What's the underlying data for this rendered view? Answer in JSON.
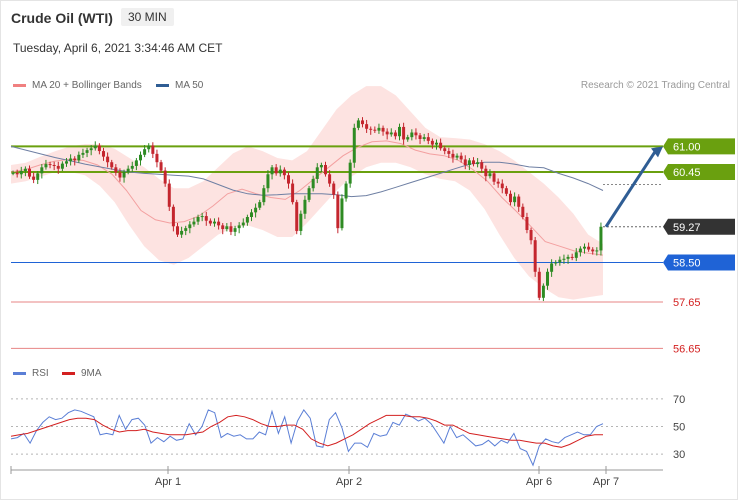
{
  "header": {
    "instrument": "Crude Oil (WTI)",
    "timeframe": "30 MIN",
    "timestamp": "Tuesday, April 6, 2021 3:34:46 AM CET"
  },
  "legend": {
    "items": [
      {
        "label": "MA 20 + Bollinger Bands",
        "color": "#f08080"
      },
      {
        "label": "MA 50",
        "color": "#2f5d94"
      }
    ],
    "credit": "Research © 2021 Trading Central"
  },
  "rsi_legend": {
    "items": [
      {
        "label": "RSI",
        "color": "#5b7fd6"
      },
      {
        "label": "9MA",
        "color": "#d32020"
      }
    ]
  },
  "chart_data": [
    {
      "type": "candlestick",
      "title": "Crude Oil (WTI)",
      "ylim": [
        56.4,
        62.0
      ],
      "x_labels": [
        "Apr 1",
        "Apr 2",
        "Apr 6",
        "Apr 7"
      ],
      "levels": [
        {
          "value": 61.0,
          "label": "61.00",
          "kind": "resistance",
          "color": "#6aa00f"
        },
        {
          "value": 60.45,
          "label": "60.45",
          "kind": "resistance",
          "color": "#6aa00f"
        },
        {
          "value": 59.27,
          "label": "59.27",
          "kind": "last",
          "color": "#333333"
        },
        {
          "value": 58.5,
          "label": "58.50",
          "kind": "pivot",
          "color": "#1f63d6"
        },
        {
          "value": 57.65,
          "label": "57.65",
          "kind": "support",
          "color": "#d32020"
        },
        {
          "value": 56.65,
          "label": "56.65",
          "kind": "support",
          "color": "#d32020"
        }
      ],
      "closes": [
        60.43,
        60.4,
        60.47,
        60.52,
        60.35,
        60.28,
        60.42,
        60.55,
        60.62,
        60.6,
        60.58,
        60.52,
        60.63,
        60.68,
        60.74,
        60.7,
        60.82,
        60.86,
        60.92,
        60.96,
        61.02,
        60.9,
        60.78,
        60.66,
        60.55,
        60.44,
        60.33,
        60.45,
        60.52,
        60.58,
        60.7,
        60.82,
        60.94,
        61.02,
        60.84,
        60.66,
        60.48,
        60.2,
        59.7,
        59.28,
        59.1,
        59.18,
        59.24,
        59.32,
        59.38,
        59.48,
        59.5,
        59.4,
        59.34,
        59.38,
        59.3,
        59.22,
        59.28,
        59.16,
        59.24,
        59.3,
        59.36,
        59.48,
        59.58,
        59.68,
        59.8,
        60.1,
        60.4,
        60.55,
        60.42,
        60.5,
        60.38,
        60.2,
        59.8,
        59.18,
        59.55,
        59.85,
        60.1,
        60.3,
        60.55,
        60.6,
        60.4,
        60.2,
        59.96,
        59.24,
        59.88,
        60.2,
        60.65,
        61.4,
        61.56,
        61.48,
        61.38,
        61.36,
        61.34,
        61.4,
        61.32,
        61.26,
        61.3,
        61.22,
        61.42,
        61.15,
        61.2,
        61.3,
        61.24,
        61.16,
        61.2,
        61.12,
        61.04,
        61.08,
        60.96,
        60.9,
        60.84,
        60.76,
        60.8,
        60.72,
        60.6,
        60.7,
        60.62,
        60.66,
        60.52,
        60.36,
        60.42,
        60.24,
        60.2,
        60.1,
        59.98,
        59.8,
        59.92,
        59.7,
        59.48,
        59.2,
        58.98,
        58.3,
        57.74,
        58.0,
        58.3,
        58.48,
        58.5,
        58.56,
        58.58,
        58.62,
        58.6,
        58.72,
        58.8,
        58.84,
        58.78,
        58.74,
        58.76,
        59.27
      ],
      "ma50": [
        61.0,
        60.92,
        60.84,
        60.76,
        60.69,
        60.62,
        60.56,
        60.5,
        60.45,
        60.42,
        60.4,
        60.38,
        60.36,
        60.3,
        60.18,
        60.06,
        59.98,
        59.95,
        59.96,
        59.98,
        59.98,
        59.98,
        59.96,
        59.92,
        59.94,
        60.02,
        60.12,
        60.22,
        60.32,
        60.42,
        60.52,
        60.62,
        60.66,
        60.66,
        60.62,
        60.56,
        60.54,
        60.42,
        60.32,
        60.2,
        60.05
      ],
      "ma20": [
        60.45,
        60.5,
        60.6,
        60.68,
        60.72,
        60.7,
        60.6,
        60.4,
        60.05,
        59.62,
        59.42,
        59.35,
        59.38,
        59.5,
        59.72,
        59.98,
        60.08,
        59.98,
        59.9,
        59.86,
        60.05,
        60.3,
        60.55,
        60.8,
        60.98,
        61.1,
        61.12,
        61.06,
        60.92,
        60.84,
        60.8,
        60.7,
        60.5,
        60.25,
        59.9,
        59.6,
        59.28,
        58.95,
        58.85,
        58.75,
        58.7,
        58.66
      ],
      "bb_upper": [
        60.6,
        60.65,
        60.78,
        60.9,
        61.0,
        61.05,
        61.05,
        60.95,
        60.75,
        60.55,
        60.3,
        60.1,
        60.1,
        60.25,
        60.55,
        60.85,
        61.0,
        60.9,
        60.75,
        60.7,
        60.9,
        61.35,
        61.8,
        62.1,
        62.3,
        62.3,
        62.1,
        61.75,
        61.4,
        61.2,
        61.18,
        61.15,
        61.05,
        60.9,
        60.7,
        60.45,
        60.2,
        59.9,
        59.55,
        59.1,
        58.9
      ],
      "bb_lower": [
        60.2,
        60.25,
        60.35,
        60.45,
        60.45,
        60.38,
        60.15,
        59.8,
        59.3,
        58.85,
        58.55,
        58.45,
        58.6,
        58.85,
        59.1,
        59.25,
        59.3,
        59.2,
        59.05,
        59.05,
        59.35,
        59.7,
        60.05,
        60.35,
        60.55,
        60.65,
        60.65,
        60.55,
        60.4,
        60.3,
        60.25,
        60.05,
        59.65,
        59.1,
        58.6,
        58.2,
        57.95,
        57.75,
        57.7,
        57.75,
        57.8
      ]
    },
    {
      "type": "line",
      "title": "RSI",
      "ylim": [
        20,
        80
      ],
      "y_ticks": [
        70,
        50,
        30
      ],
      "series": [
        {
          "name": "RSI",
          "color": "#5b7fd6",
          "values": [
            41,
            42,
            45,
            38,
            47,
            53,
            57,
            55,
            56,
            60,
            62,
            61,
            59,
            57,
            44,
            45,
            44,
            58,
            48,
            55,
            56,
            51,
            38,
            42,
            39,
            43,
            40,
            41,
            52,
            44,
            50,
            62,
            60,
            42,
            45,
            43,
            44,
            41,
            41,
            46,
            44,
            61,
            45,
            57,
            38,
            54,
            62,
            56,
            36,
            35,
            55,
            60,
            49,
            32,
            38,
            38,
            35,
            45,
            43,
            44,
            53,
            51,
            59,
            57,
            54,
            56,
            52,
            45,
            38,
            50,
            42,
            44,
            40,
            36,
            37,
            40,
            36,
            40,
            38,
            45,
            34,
            32,
            22,
            36,
            41,
            39,
            38,
            42,
            44,
            46,
            44,
            44,
            50,
            52
          ]
        },
        {
          "name": "9MA",
          "color": "#d32020",
          "values": [
            43,
            44,
            45,
            47,
            49,
            51,
            53,
            55,
            56,
            56,
            55,
            51,
            48,
            46,
            47,
            47,
            48,
            46,
            45,
            44,
            44,
            44,
            45,
            46,
            50,
            53,
            57,
            58,
            57,
            55,
            52,
            50,
            50,
            51,
            51,
            48,
            41,
            38,
            36,
            38,
            41,
            44,
            48,
            52,
            55,
            58,
            58,
            58,
            57,
            57,
            56,
            54,
            51,
            51,
            48,
            45,
            44,
            43,
            42,
            41,
            40,
            40,
            39,
            38,
            38,
            36,
            35,
            37,
            40,
            43,
            44,
            44
          ]
        }
      ]
    }
  ]
}
